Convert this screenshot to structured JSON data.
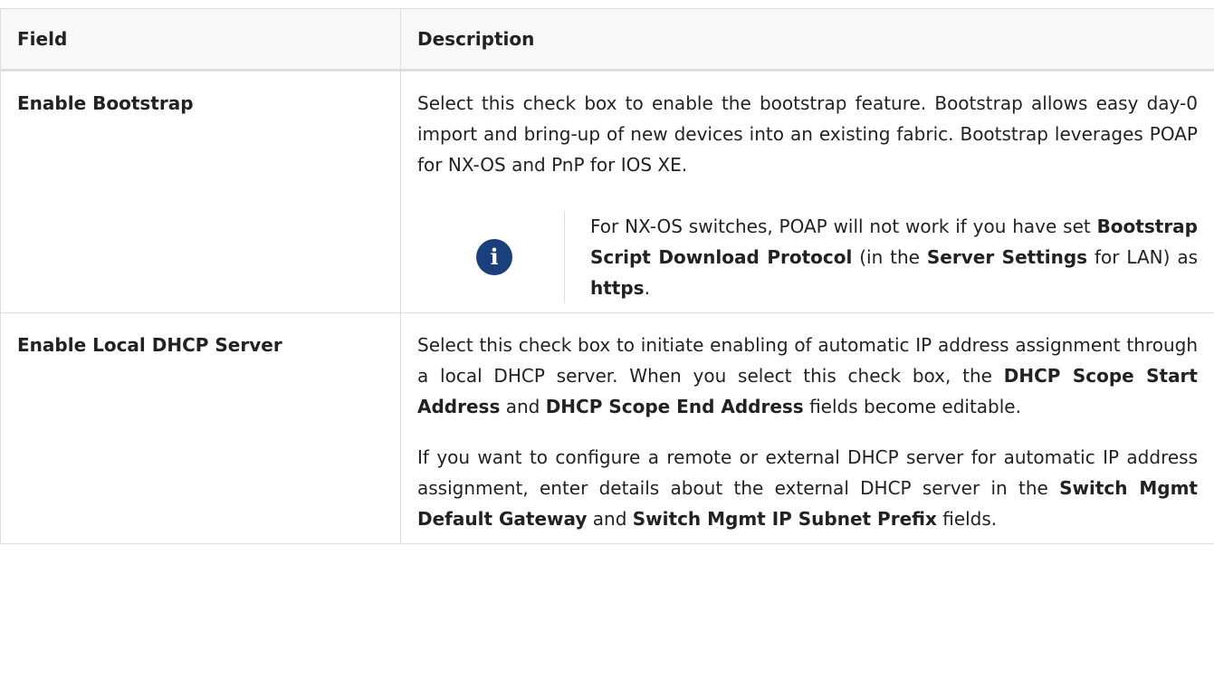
{
  "table": {
    "headers": {
      "field": "Field",
      "description": "Description"
    },
    "rows": [
      {
        "field": "Enable Bootstrap",
        "description": [
          {
            "type": "paragraph",
            "segments": [
              {
                "text": "Select this check box to enable the bootstrap feature. Bootstrap allows easy day-0 import and bring-up of new devices into an existing fabric. Bootstrap leverages POAP for NX-OS and PnP for IOS XE.",
                "bold": false
              }
            ]
          },
          {
            "type": "note",
            "icon": "info-icon",
            "segments": [
              {
                "text": "For NX-OS switches, POAP will not work if you have set ",
                "bold": false
              },
              {
                "text": "Bootstrap Script Download Protocol",
                "bold": true
              },
              {
                "text": " (in the ",
                "bold": false
              },
              {
                "text": "Server Settings",
                "bold": true
              },
              {
                "text": " for LAN) as ",
                "bold": false
              },
              {
                "text": "https",
                "bold": true
              },
              {
                "text": ".",
                "bold": false
              }
            ]
          }
        ]
      },
      {
        "field": "Enable Local DHCP Server",
        "description": [
          {
            "type": "paragraph",
            "segments": [
              {
                "text": "Select this check box to initiate enabling of automatic IP address assignment through a local DHCP server. When you select this check box, the ",
                "bold": false
              },
              {
                "text": "DHCP Scope Start Address",
                "bold": true
              },
              {
                "text": " and ",
                "bold": false
              },
              {
                "text": "DHCP Scope End Address",
                "bold": true
              },
              {
                "text": " fields become editable.",
                "bold": false
              }
            ]
          },
          {
            "type": "paragraph",
            "segments": [
              {
                "text": "If you want to configure a remote or external DHCP server for automatic IP address assignment, enter details about the external DHCP server in the ",
                "bold": false
              },
              {
                "text": "Switch Mgmt Default Gateway",
                "bold": true
              },
              {
                "text": " and ",
                "bold": false
              },
              {
                "text": "Switch Mgmt IP Subnet Prefix",
                "bold": true
              },
              {
                "text": " fields.",
                "bold": false
              }
            ]
          }
        ]
      }
    ]
  },
  "colors": {
    "icon_background": "#19407c",
    "header_background": "#f7f8f7",
    "border": "#dedede",
    "text": "#222222"
  }
}
